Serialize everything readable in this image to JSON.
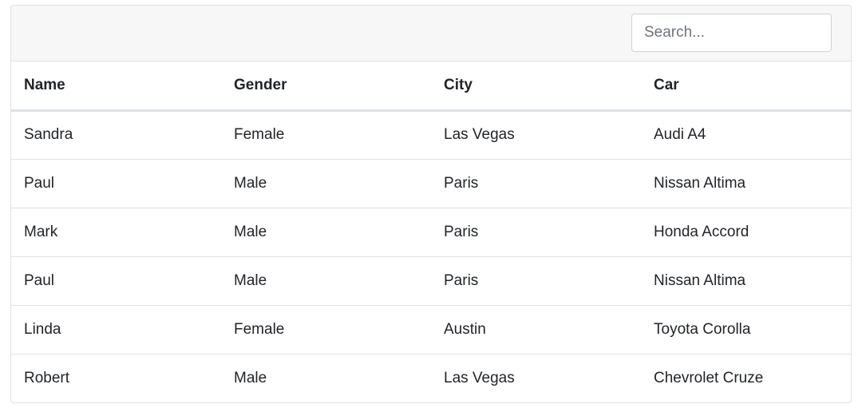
{
  "search": {
    "placeholder": "Search...",
    "value": ""
  },
  "table": {
    "columns": [
      "Name",
      "Gender",
      "City",
      "Car"
    ],
    "rows": [
      [
        "Sandra",
        "Female",
        "Las Vegas",
        "Audi A4"
      ],
      [
        "Paul",
        "Male",
        "Paris",
        "Nissan Altima"
      ],
      [
        "Mark",
        "Male",
        "Paris",
        "Honda Accord"
      ],
      [
        "Paul",
        "Male",
        "Paris",
        "Nissan Altima"
      ],
      [
        "Linda",
        "Female",
        "Austin",
        "Toyota Corolla"
      ],
      [
        "Robert",
        "Male",
        "Las Vegas",
        "Chevrolet Cruze"
      ]
    ]
  },
  "colors": {
    "toolbar_bg": "#f7f7f7",
    "border": "#dee2e6",
    "text": "#212529"
  }
}
